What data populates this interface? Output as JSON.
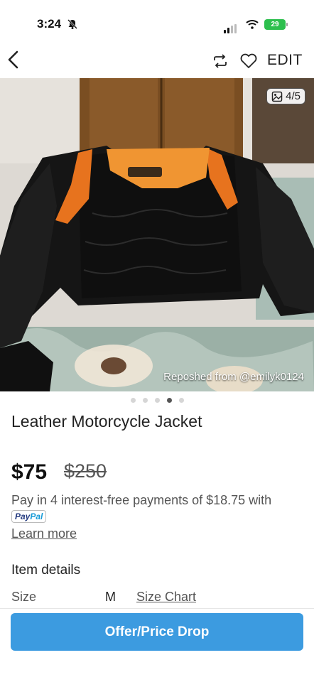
{
  "status": {
    "time": "3:24",
    "battery": "29"
  },
  "nav": {
    "edit_label": "EDIT"
  },
  "photo": {
    "counter": "4/5",
    "repost_text": "Reposhed from @emilyk0124",
    "dots_total": 5,
    "dots_active": 4
  },
  "listing": {
    "title": "Leather Motorcycle Jacket",
    "price": "$75",
    "original_price": "$250",
    "paypal_text": "Pay in 4 interest-free payments of $18.75 with",
    "paypal_badge_a": "Pay",
    "paypal_badge_b": "Pal",
    "learn_more": "Learn more"
  },
  "details": {
    "heading": "Item details",
    "size_label": "Size",
    "size_value": "M",
    "size_chart": "Size Chart"
  },
  "cta": {
    "label": "Offer/Price Drop"
  },
  "colors": {
    "accent": "#3c9be0",
    "battery": "#2dbf4e"
  }
}
